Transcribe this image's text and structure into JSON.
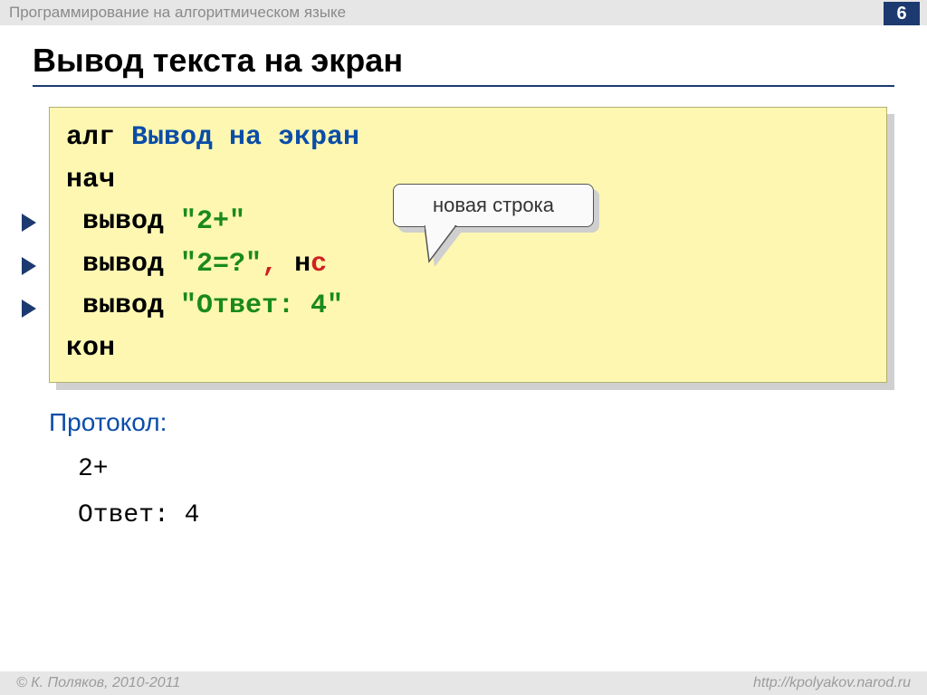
{
  "header": {
    "title": "Программирование на алгоритмическом языке"
  },
  "page_number": "6",
  "slide_title": "Вывод текста на экран",
  "code": {
    "l1_alg": "алг ",
    "l1_name": "Вывод на экран",
    "l2": "нач",
    "l3_kw": " вывод ",
    "l3_str": "\"2+\"",
    "l4_kw": " вывод ",
    "l4_str": "\"2=?\"",
    "l4_comma": ", ",
    "l4_nc1": "н",
    "l4_nc2": "с",
    "l5_kw": " вывод ",
    "l5_str": "\"Ответ: 4\"",
    "l6": "кон"
  },
  "callout": "новая строка",
  "protocol": {
    "label": "Протокол:",
    "line1": "2+",
    "line2": "Ответ: 4"
  },
  "footer": {
    "left": "© К. Поляков, 2010-2011",
    "right": "http://kpolyakov.narod.ru"
  }
}
